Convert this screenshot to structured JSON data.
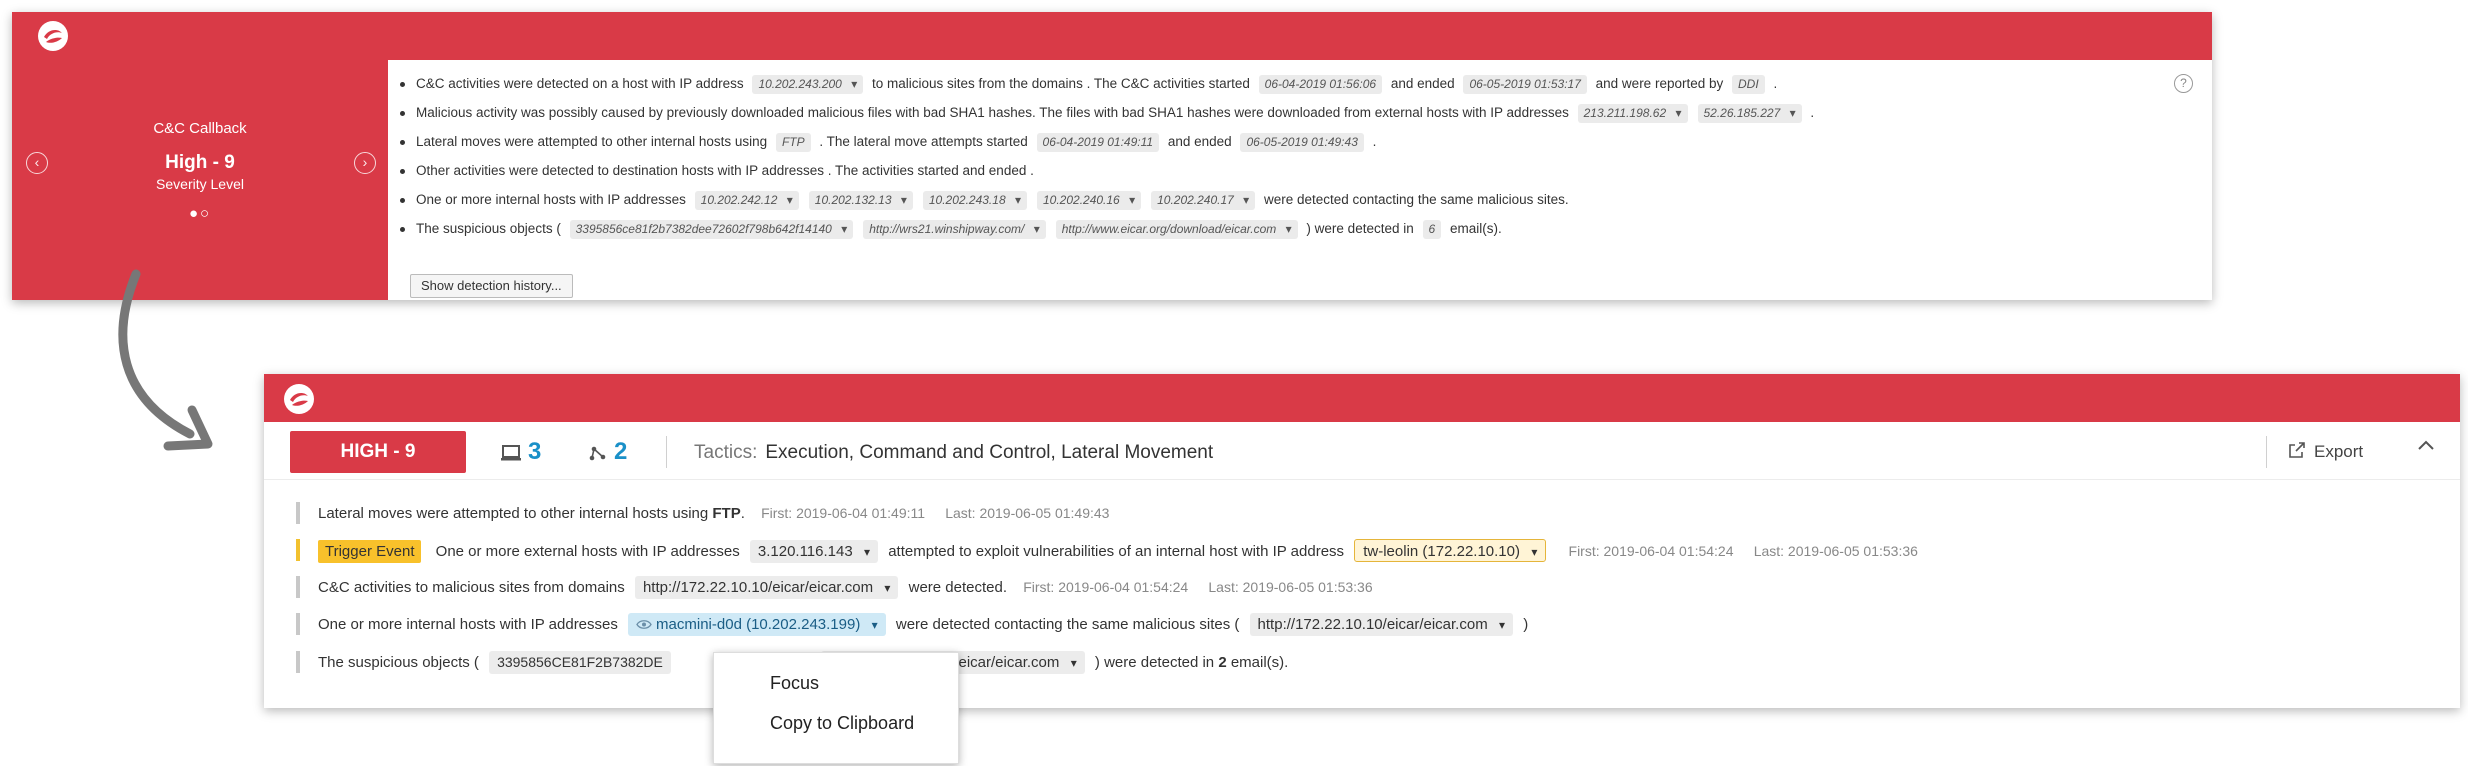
{
  "old_view": {
    "severity": {
      "category": "C&C Callback",
      "level": "High - 9",
      "sublabel": "Severity Level",
      "dots": "●○"
    },
    "bullets": [
      {
        "t1": "C&C activities were detected on a host with IP address",
        "ip": "10.202.243.200",
        "t2": "to malicious sites from the domains . The C&C activities started",
        "started": "06-04-2019 01:56:06",
        "t3": "and ended",
        "ended": "06-05-2019 01:53:17",
        "t4": "and were reported by",
        "reporter": "DDI",
        "t5": "."
      },
      {
        "t1": "Malicious activity was possibly caused by previously downloaded malicious files with bad SHA1 hashes. The files with bad SHA1 hashes were downloaded from external hosts with IP addresses",
        "ips": [
          "213.211.198.62",
          "52.26.185.227"
        ],
        "t2": "."
      },
      {
        "t1": "Lateral moves were attempted to other internal hosts using",
        "protocol": "FTP",
        "t2": ". The lateral move attempts started",
        "started": "06-04-2019 01:49:11",
        "t3": "and ended",
        "ended": "06-05-2019 01:49:43",
        "t4": "."
      },
      {
        "t1": "Other activities were detected to destination hosts with IP addresses . The activities started and ended ."
      },
      {
        "t1": "One or more internal hosts with IP addresses",
        "ips": [
          "10.202.242.12",
          "10.202.132.13",
          "10.202.243.18",
          "10.202.240.16",
          "10.202.240.17"
        ],
        "t2": "were detected contacting the same malicious sites."
      },
      {
        "t1": "The suspicious objects (",
        "objects": [
          "3395856ce81f2b7382dee72602f798b642f14140",
          "http://wrs21.winshipway.com/",
          "http://www.eicar.org/download/eicar.com"
        ],
        "t2": ") were detected in",
        "count": "6",
        "t3": "email(s)."
      }
    ],
    "history_button": "Show detection history...",
    "help_glyph": "?"
  },
  "new_view": {
    "severity_badge": "HIGH - 9",
    "hosts_count": "3",
    "users_count": "2",
    "tactics_label": "Tactics:",
    "tactics_value": "Execution, Command and Control, Lateral Movement",
    "export_label": "Export",
    "rows": [
      {
        "t1": "Lateral moves were attempted to other internal hosts using",
        "protocol": "FTP",
        "t2": ".",
        "first": "First:  2019-06-04 01:49:11",
        "last": "Last:  2019-06-05 01:49:43"
      },
      {
        "trigger": "Trigger Event",
        "t1": "One or more external hosts with IP addresses",
        "ip": "3.120.116.143",
        "t2": "attempted to exploit vulnerabilities of an internal host with IP address",
        "host": "tw-leolin (172.22.10.10)",
        "first": "First:  2019-06-04 01:54:24",
        "last": "Last: 2019-06-05 01:53:36"
      },
      {
        "t1": "C&C activities to malicious sites from domains",
        "domain": "http://172.22.10.10/eicar/eicar.com",
        "t2": "were detected.",
        "first": "First:  2019-06-04 01:54:24",
        "last": "Last: 2019-06-05 01:53:36"
      },
      {
        "t1": "One or more internal hosts with IP addresses",
        "host": "macmini-d0d (10.202.243.199)",
        "t2": "were detected contacting the same malicious sites (",
        "site": "http://172.22.10.10/eicar/eicar.com",
        "t3": ")"
      },
      {
        "t1": "The suspicious objects (",
        "hash": "3395856CE81F2B7382DE",
        "site": "http://172.22.10.10/eicar/eicar.com",
        "t2": ")  were detected in",
        "count": "2",
        "t3": "email(s)."
      }
    ],
    "context_menu": [
      "Focus",
      "Copy to Clipboard"
    ]
  },
  "colors": {
    "brand_red": "#d93a47",
    "link_blue": "#1a90c8",
    "trigger_yellow": "#f8c12b"
  },
  "icons": [
    "logo-icon",
    "help-icon",
    "chevron-left-icon",
    "chevron-right-icon",
    "laptop-icon",
    "network-icon",
    "export-icon",
    "chevron-up-icon",
    "eye-icon",
    "arrow-icon"
  ]
}
